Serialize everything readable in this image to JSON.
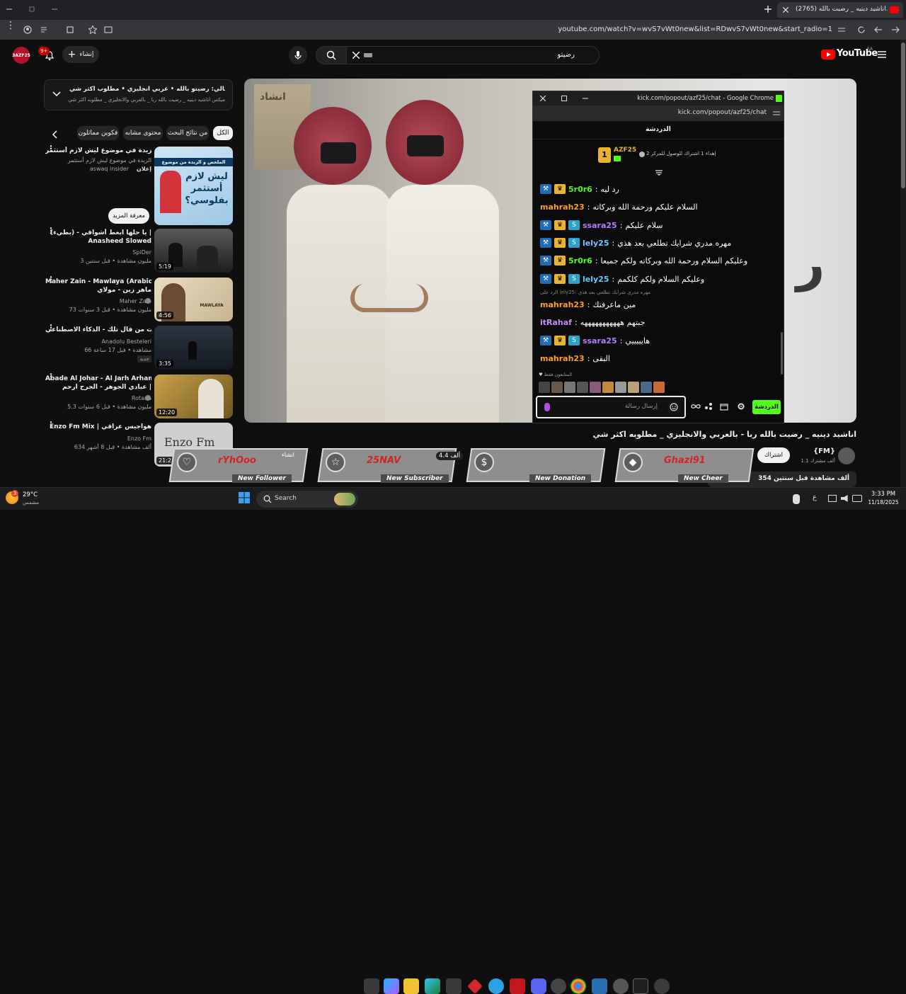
{
  "browser": {
    "tab_title": "(2765) اناشيد دينيه _ رضيت بالله...",
    "url": "youtube.com/watch?v=wvS7vWt0new&list=RDwvS7vWt0new&start_radio=1"
  },
  "youtube": {
    "logo_text": "YouTube",
    "country": "SA",
    "search_value": "رضيتو",
    "create_label": "إنشاء",
    "notif_count": "9+",
    "avatar_text": "3AZF25"
  },
  "playlist": {
    "title": "التالي: رضيتو بالله • عربي انجليزي • مطلوب اكثر شي",
    "subtitle": "ميكس اناشيد دينيه _ رضيت بالله ربا _ بالعربي والانجليزي _ مطلوبه اكثر شي"
  },
  "chips": [
    "الكل",
    "من نتائج البحث",
    "محتوى مشابه",
    "فكوين مماثلون"
  ],
  "suggestions": [
    {
      "title": "الزيدة في موضوع ليش لازم أستثمر",
      "line2": "الزيدة في موضوع ليش لازم أستثمر",
      "channel": "aswaq insider",
      "meta": "إعلان",
      "duration": "",
      "thumb_text": "ليش لازم أستثمر بفلوسي؟",
      "thumb_header": "الملخص و الزبدة من موضوع"
    },
    {
      "title": "يا حلها ابغط أشواقي - (بطيء) |",
      "line2": "Anasheed Slowed",
      "channel": "SpiDer",
      "meta": "3 مليون مشاهدة • قبل سنتين",
      "duration": "5:19"
    },
    {
      "title": "Maher Zain - Mawlaya (Arabic) |",
      "line2": "ماهر زين - مولاي",
      "channel": "Maher Zain",
      "meta": "73 مليون مشاهدة • قبل 3 سنوات",
      "duration": "4:56",
      "thumb_text": "MAWLAYA"
    },
    {
      "title": "أنت من قال تلك - الذكاء الاصطناعي",
      "line2": "",
      "channel": "Anadolu Besteleri",
      "meta": "66 مشاهدة • قبل 17 ساعة",
      "duration": "3:35",
      "extra": "جديد"
    },
    {
      "title": "Abade Al Johar - Al Jarh Arham",
      "line2": "عبادي الجوهر - الجرح ارحم |",
      "channel": "Rotana",
      "meta": "5.3 مليون مشاهدة • قبل 6 سنوات",
      "duration": "12:20"
    },
    {
      "title": "Enzo Fm Mix | هواجيس عراقي",
      "line2": "",
      "channel": "Enzo Fm",
      "meta": "634 ألف مشاهدة • قبل 8 أشهر",
      "duration": "21:2",
      "thumb_text": "Enzo Fm"
    }
  ],
  "more_button": "معرفة المزيد",
  "video": {
    "title": "اناشيد دينيه _ رضيت بالله ربا - بالعربي والانجليزي _ مطلوبه اكثر شي",
    "channel": "{FM}",
    "subs": "1.1 ألف مشترك",
    "subscribe": "اشتراك",
    "views": "354 ألف مشاهدة قبل سنتين",
    "watermark_top": "انشاد",
    "side_text": "ر"
  },
  "chat_window": {
    "title": "kick.com/popout/azf25/chat - Google Chrome",
    "url": "kick.com/popout/azf25/chat",
    "header": "الدردشة",
    "pinned_user": "AZF25",
    "pinned_rank": "1",
    "pinned_text": "إهداء 1 اشتراك للوصول للمركز 2",
    "reply_note": "الرد على lely25: مهره مدري شرايك تطلعي بعد هذي",
    "messages": [
      {
        "user": "5r0r6",
        "text": "رد ليه",
        "color": "#53fc18",
        "badges": 2
      },
      {
        "user": "mahrah23",
        "text": "السلام عليكم ورحمة الله وبركاته",
        "color": "#ff9f1a",
        "badges": 0
      },
      {
        "user": "ssara25",
        "text": "سلام عليكم",
        "color": "#b57cff",
        "badges": 3
      },
      {
        "user": "lely25",
        "text": "مهره مدري شرايك تطلعي بعد هذي",
        "color": "#6ec6ff",
        "badges": 3
      },
      {
        "user": "5r0r6",
        "text": "وعليكم السلام ورحمة الله وبركاته ولكم جميعا",
        "color": "#53fc18",
        "badges": 2
      },
      {
        "user": "lely25",
        "text": "وعليكم السلام ولكم كلكمم",
        "color": "#6ec6ff",
        "badges": 3
      },
      {
        "user": "mahrah23",
        "text": "مين ماعرفتك",
        "color": "#ff9f1a",
        "badges": 0
      },
      {
        "user": "itRahaf",
        "text": "جبتهم هههههههههههه",
        "color": "#c58bff",
        "badges": 0
      },
      {
        "user": "ssara25",
        "text": "هايييييي",
        "color": "#b57cff",
        "badges": 3
      },
      {
        "user": "mahrah23",
        "text": "البقى",
        "color": "#ff9f1a",
        "badges": 0
      }
    ],
    "supporters_label": "المتابعون فقط",
    "input_placeholder": "إرسال رسالة",
    "send_label": "الدردشة"
  },
  "alerts": [
    {
      "name": "rYhOoo",
      "label": "New Follower"
    },
    {
      "name": "25NAV",
      "label": "New Subscriber"
    },
    {
      "name": "",
      "label": "New Donation"
    },
    {
      "name": "Ghazi91",
      "label": "New Cheer"
    }
  ],
  "alerts_extra": [
    "4.4 ألف",
    "انشاء"
  ],
  "taskbar": {
    "weather_temp": "29°C",
    "weather_desc": "مشمس",
    "search": "Search",
    "time": "3:33 PM",
    "date": "11/18/2025",
    "lang": "ع"
  },
  "colors": {
    "accent": "#53fc18",
    "yt_red": "#ff0000",
    "chat_bg": "#0b0b0b"
  }
}
